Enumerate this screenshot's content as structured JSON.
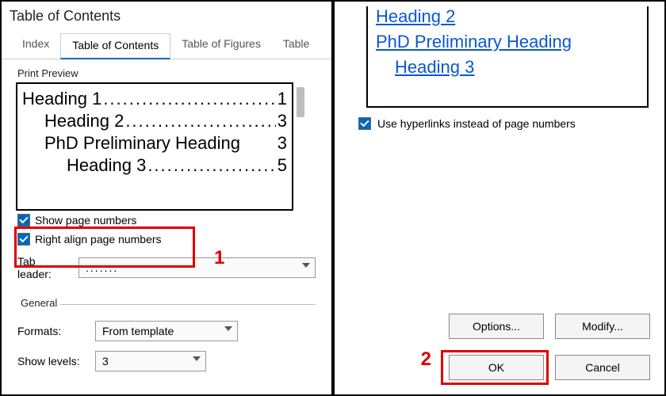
{
  "dialog": {
    "title": "Table of Contents",
    "tabs": [
      "Index",
      "Table of Contents",
      "Table of Figures",
      "Table"
    ],
    "active_tab": 1,
    "print_preview_label": "Print Preview",
    "preview_rows": [
      {
        "label": "Heading 1",
        "leader": ".................................",
        "page": "1",
        "indent": 0
      },
      {
        "label": "Heading 2",
        "leader": "........................",
        "page": "3",
        "indent": 1
      },
      {
        "label": "PhD Preliminary Heading",
        "leader": "",
        "page": "3",
        "indent": 1
      },
      {
        "label": "Heading 3",
        "leader": ".....................",
        "page": "5",
        "indent": 2
      }
    ],
    "show_page_numbers_label": "Show page numbers",
    "right_align_label": "Right align page numbers",
    "tab_leader_label": "Tab leader:",
    "tab_leader_value": ".......",
    "general_label": "General",
    "formats_label": "Formats:",
    "formats_value": "From template",
    "show_levels_label": "Show levels:",
    "show_levels_value": "3"
  },
  "right": {
    "web_links": [
      {
        "label": "Heading 2",
        "indent": 0
      },
      {
        "label": "PhD Preliminary Heading",
        "indent": 0
      },
      {
        "label": "Heading 3",
        "indent": 1
      }
    ],
    "hyperlinks_label": "Use hyperlinks instead of page numbers",
    "options_label": "Options...",
    "modify_label": "Modify...",
    "ok_label": "OK",
    "cancel_label": "Cancel"
  },
  "callouts": {
    "one": "1",
    "two": "2"
  }
}
